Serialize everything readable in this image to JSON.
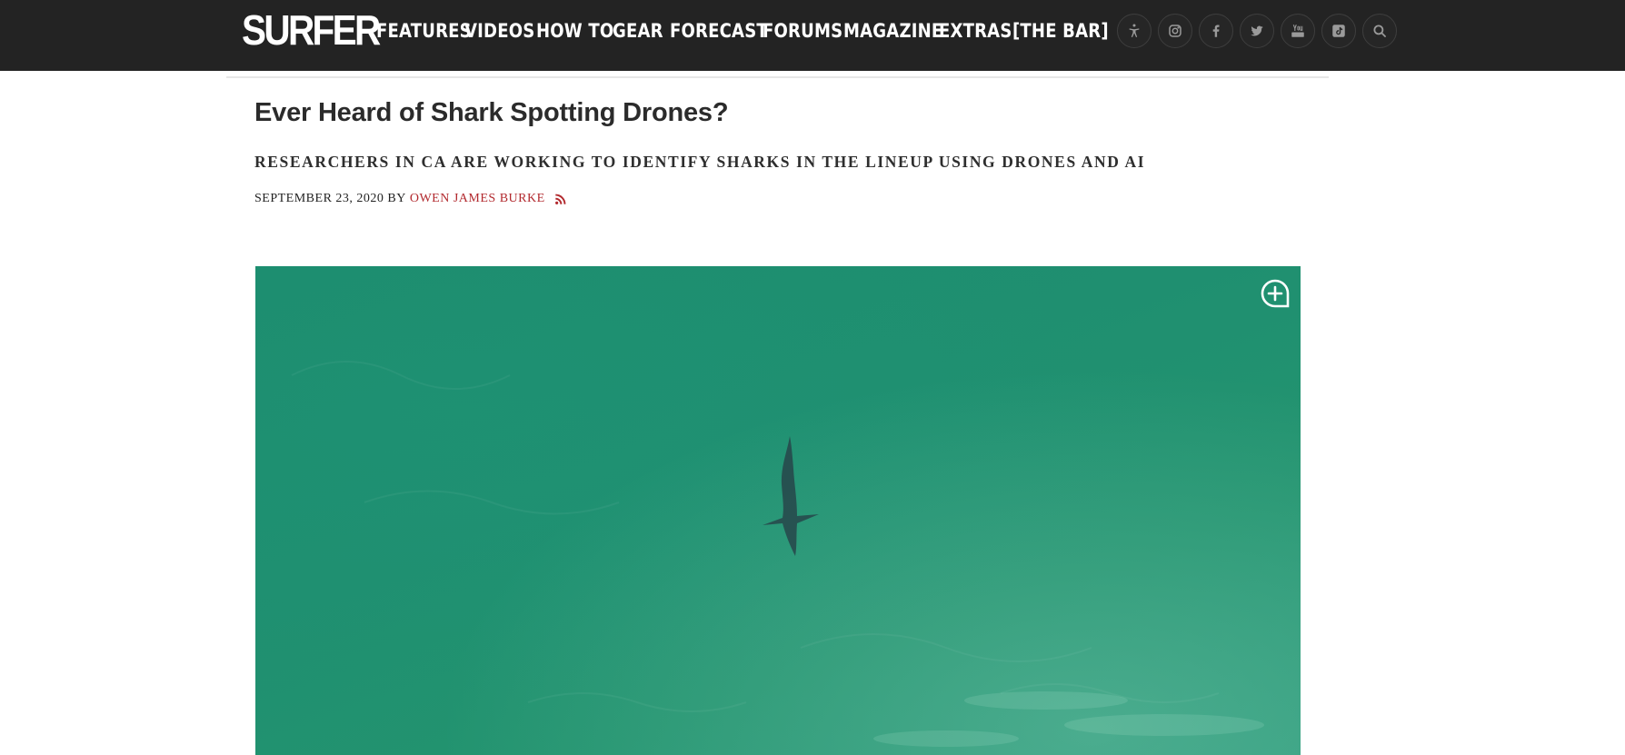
{
  "site": {
    "logo_text": "SURFER"
  },
  "nav": {
    "items": [
      {
        "label": "FEATURES"
      },
      {
        "label": "VIDEOS"
      },
      {
        "label": "HOW TO"
      },
      {
        "label": "GEAR"
      },
      {
        "label": "FORECAST"
      },
      {
        "label": "FORUMS"
      },
      {
        "label": "MAGAZINE"
      },
      {
        "label": "EXTRAS"
      },
      {
        "label": "[THE BAR]"
      }
    ]
  },
  "header_icons": [
    "accessibility-icon",
    "instagram-icon",
    "facebook-icon",
    "twitter-icon",
    "youtube-icon",
    "tiktok-icon",
    "search-icon"
  ],
  "article": {
    "title": "Ever Heard of Shark Spotting Drones?",
    "subtitle": "RESEARCHERS IN CA ARE WORKING TO IDENTIFY SHARKS IN THE LINEUP USING DRONES AND AI",
    "date": "SEPTEMBER 23, 2020",
    "by": "BY",
    "author": "OWEN JAMES BURKE",
    "rss_icon": "rss-icon"
  },
  "hero": {
    "zoom_icon": "expand-plus-icon"
  },
  "colors": {
    "header_bg": "#232323",
    "author_red": "#b2292e",
    "water_green": "#1f8f70"
  }
}
